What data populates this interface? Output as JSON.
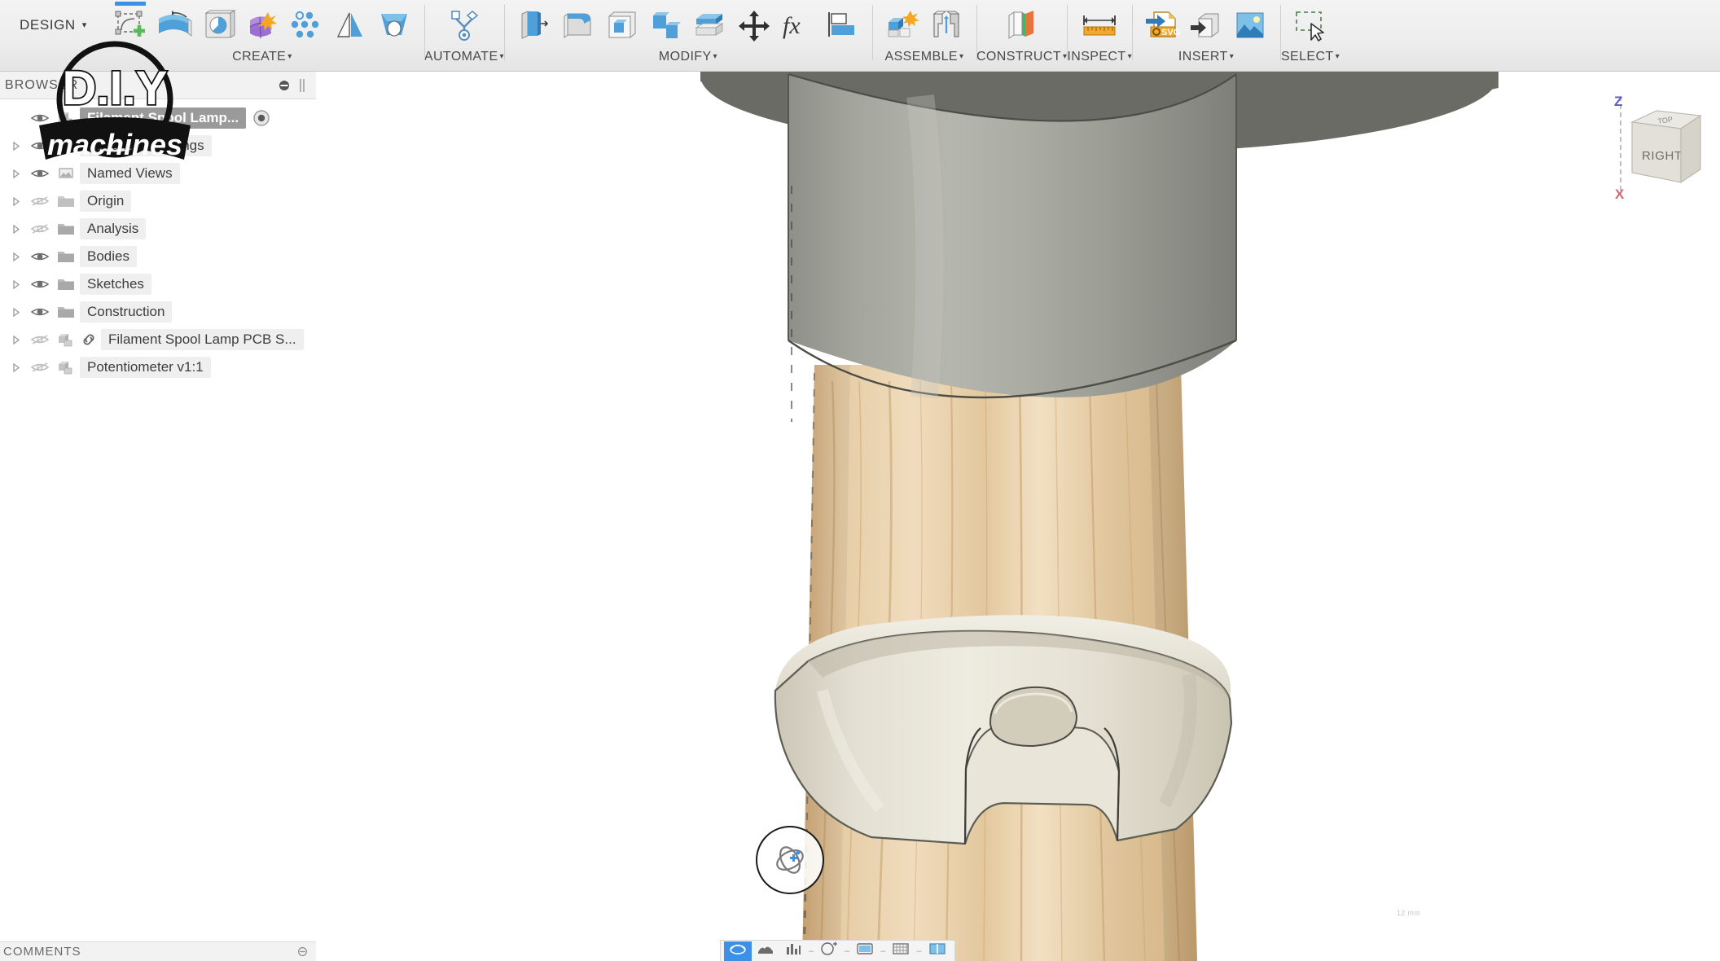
{
  "app": {
    "workspace_menu": "DESIGN",
    "caret": "▾"
  },
  "toolbar": {
    "groups": [
      {
        "name": "create",
        "label": "CREATE",
        "has_caret": true,
        "buttons": [
          {
            "name": "create-sketch",
            "icon": "create-sketch-icon",
            "active": true
          },
          {
            "name": "extrude",
            "icon": "extrude-icon",
            "active": false
          },
          {
            "name": "revolve",
            "icon": "revolve-icon",
            "active": false
          },
          {
            "name": "form",
            "icon": "form-icon",
            "active": false
          },
          {
            "name": "pattern",
            "icon": "pattern-icon",
            "active": false
          },
          {
            "name": "mirror",
            "icon": "mirror-icon",
            "active": false
          },
          {
            "name": "loft",
            "icon": "loft-icon",
            "active": false
          }
        ]
      },
      {
        "name": "automate",
        "label": "AUTOMATE",
        "has_caret": true,
        "buttons": [
          {
            "name": "automate-tool",
            "icon": "automate-icon",
            "active": false
          }
        ]
      },
      {
        "name": "modify",
        "label": "MODIFY",
        "has_caret": true,
        "buttons": [
          {
            "name": "press-pull",
            "icon": "press-pull-icon",
            "active": false
          },
          {
            "name": "fillet",
            "icon": "fillet-icon",
            "active": false
          },
          {
            "name": "shell",
            "icon": "shell-icon",
            "active": false
          },
          {
            "name": "combine",
            "icon": "combine-icon",
            "active": false
          },
          {
            "name": "offset-face",
            "icon": "offset-face-icon",
            "active": false
          },
          {
            "name": "move-copy",
            "icon": "move-copy-icon",
            "active": false
          },
          {
            "name": "change-parameters",
            "icon": "fx-icon",
            "active": false
          },
          {
            "name": "align",
            "icon": "align-icon",
            "active": false
          }
        ]
      },
      {
        "name": "assemble",
        "label": "ASSEMBLE",
        "has_caret": true,
        "buttons": [
          {
            "name": "new-component",
            "icon": "new-component-icon",
            "active": false
          },
          {
            "name": "joint",
            "icon": "joint-icon",
            "active": false
          }
        ]
      },
      {
        "name": "construct",
        "label": "CONSTRUCT",
        "has_caret": true,
        "buttons": [
          {
            "name": "offset-plane",
            "icon": "offset-plane-icon",
            "active": false
          }
        ]
      },
      {
        "name": "inspect",
        "label": "INSPECT",
        "has_caret": true,
        "buttons": [
          {
            "name": "measure",
            "icon": "measure-icon",
            "active": false
          }
        ]
      },
      {
        "name": "insert",
        "label": "INSERT",
        "has_caret": true,
        "buttons": [
          {
            "name": "insert-svg",
            "icon": "insert-svg-icon",
            "active": false
          },
          {
            "name": "insert-mcmaster",
            "icon": "insert-mesh-icon",
            "active": false
          },
          {
            "name": "canvas",
            "icon": "insert-image-icon",
            "active": false
          }
        ]
      },
      {
        "name": "select",
        "label": "SELECT",
        "has_caret": true,
        "buttons": [
          {
            "name": "select-tool",
            "icon": "select-window-icon",
            "active": false
          }
        ]
      }
    ]
  },
  "browser": {
    "title": "BROWSER",
    "minimize_icon": "minimize-icon",
    "grip_icon": "panel-grip-icon",
    "items": [
      {
        "label": "Filament Spool Lamp...",
        "icon": "component-icon",
        "visible": true,
        "selected": true,
        "expandable": false,
        "linked": false,
        "trailing_icon": "activate-component-icon"
      },
      {
        "label": "Document Settings",
        "icon": "document-settings-icon",
        "visible": true,
        "selected": false,
        "expandable": true,
        "linked": false,
        "trailing_icon": null
      },
      {
        "label": "Named Views",
        "icon": "named-views-icon",
        "visible": true,
        "selected": false,
        "expandable": true,
        "linked": false,
        "trailing_icon": null
      },
      {
        "label": "Origin",
        "icon": "origin-folder-icon",
        "visible": false,
        "selected": false,
        "expandable": true,
        "linked": false,
        "trailing_icon": null
      },
      {
        "label": "Analysis",
        "icon": "folder-icon",
        "visible": false,
        "selected": false,
        "expandable": true,
        "linked": false,
        "trailing_icon": null
      },
      {
        "label": "Bodies",
        "icon": "folder-icon",
        "visible": true,
        "selected": false,
        "expandable": true,
        "linked": false,
        "trailing_icon": null
      },
      {
        "label": "Sketches",
        "icon": "folder-icon",
        "visible": true,
        "selected": false,
        "expandable": true,
        "linked": false,
        "trailing_icon": null
      },
      {
        "label": "Construction",
        "icon": "folder-icon",
        "visible": true,
        "selected": false,
        "expandable": true,
        "linked": false,
        "trailing_icon": null
      },
      {
        "label": "Filament Spool Lamp PCB S...",
        "icon": "component-icon",
        "visible": false,
        "selected": false,
        "expandable": true,
        "linked": true,
        "trailing_icon": null
      },
      {
        "label": "Potentiometer v1:1",
        "icon": "component-icon",
        "visible": false,
        "selected": false,
        "expandable": true,
        "linked": false,
        "trailing_icon": null
      }
    ]
  },
  "viewcube": {
    "front_face": "RIGHT",
    "top_face": "TOP",
    "axis_z": "Z",
    "axis_x": "X"
  },
  "viewport": {
    "orbit_widget_icon": "free-orbit-icon",
    "dim_label": "12 mm",
    "model_description": "Filament spool lamp assembly: grey cylindrical lamp shade cap atop a light oak wooden dowel with a cream 3D-printed split clamp ring"
  },
  "navbar": {
    "buttons": [
      {
        "name": "orbit",
        "icon": "orbit-icon",
        "selected": true,
        "sep": false
      },
      {
        "name": "pan",
        "icon": "pan-icon",
        "selected": false,
        "sep": false
      },
      {
        "name": "zoom",
        "icon": "zoom-icon",
        "selected": false,
        "sep": false
      },
      {
        "name": "fit",
        "icon": "fit-icon",
        "selected": false,
        "sep": true
      },
      {
        "name": "display-settings",
        "icon": "display-settings-icon",
        "selected": false,
        "sep": true
      },
      {
        "name": "grid-snaps",
        "icon": "grid-snaps-icon",
        "selected": false,
        "sep": true
      },
      {
        "name": "viewports",
        "icon": "viewports-icon",
        "selected": false,
        "sep": true
      }
    ]
  },
  "comments": {
    "title": "COMMENTS",
    "minimize_icon": "minimize-icon"
  },
  "logo": {
    "line1": "D.I.Y",
    "line2": "machines"
  },
  "colors": {
    "accent": "#3c91e6",
    "toolbar_bg": "#ededed",
    "selection": "#9a9a9a",
    "wood": "#e0c49a",
    "plastic": "#ded9cc",
    "shade_grey": "#9a9b94"
  }
}
